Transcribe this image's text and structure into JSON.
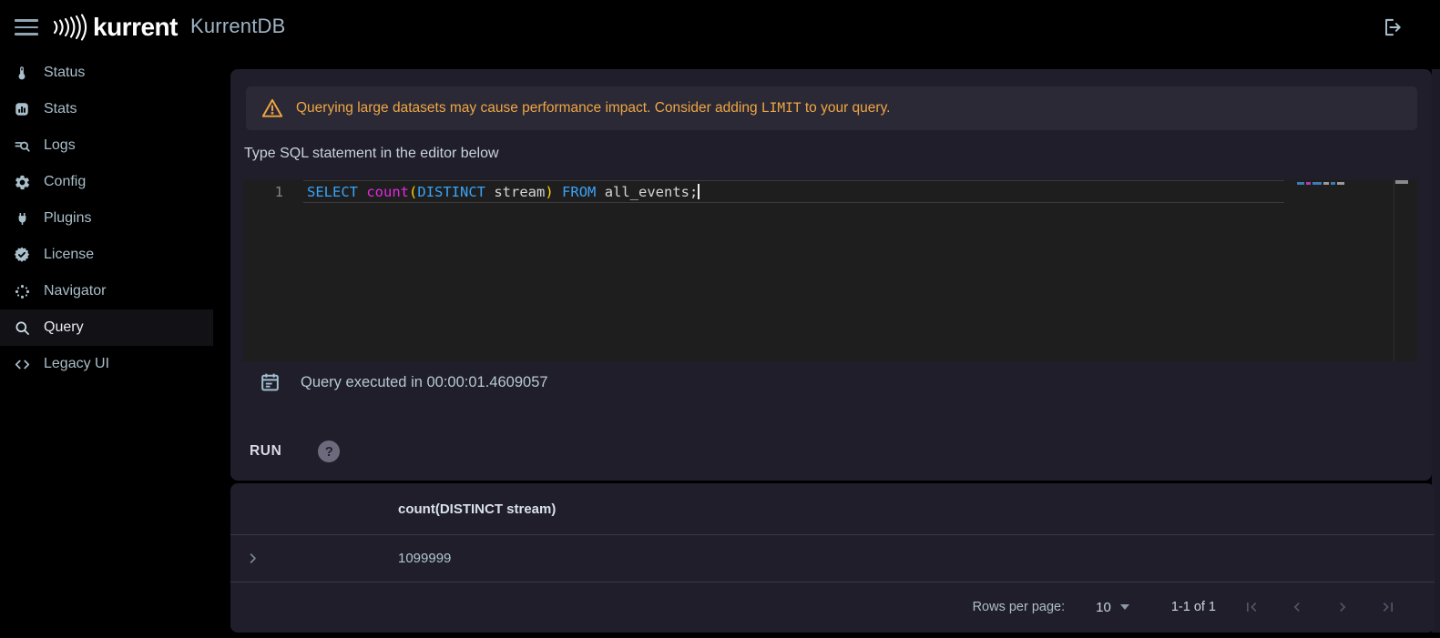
{
  "header": {
    "brand": "kurrent",
    "app_title": "KurrentDB"
  },
  "sidebar": {
    "items": [
      {
        "label": "Status",
        "icon": "thermometer-icon",
        "selected": false
      },
      {
        "label": "Stats",
        "icon": "bar-chart-icon",
        "selected": false
      },
      {
        "label": "Logs",
        "icon": "log-search-icon",
        "selected": false
      },
      {
        "label": "Config",
        "icon": "gear-icon",
        "selected": false
      },
      {
        "label": "Plugins",
        "icon": "plug-icon",
        "selected": false
      },
      {
        "label": "License",
        "icon": "license-badge-icon",
        "selected": false
      },
      {
        "label": "Navigator",
        "icon": "navigator-dots-icon",
        "selected": false
      },
      {
        "label": "Query",
        "icon": "search-icon",
        "selected": true
      },
      {
        "label": "Legacy UI",
        "icon": "code-brackets-icon",
        "selected": false
      }
    ]
  },
  "query_panel": {
    "warning": {
      "text_before": "Querying large datasets may cause performance impact. Consider adding ",
      "code": "LIMIT",
      "text_after": " to your query."
    },
    "editor_label": "Type SQL statement in the editor below",
    "editor": {
      "line_number": "1",
      "tokens": [
        {
          "text": "SELECT",
          "type": "keyword"
        },
        {
          "text": " ",
          "type": "plain"
        },
        {
          "text": "count",
          "type": "function"
        },
        {
          "text": "(",
          "type": "paren"
        },
        {
          "text": "DISTINCT",
          "type": "keyword"
        },
        {
          "text": " stream",
          "type": "plain"
        },
        {
          "text": ")",
          "type": "paren"
        },
        {
          "text": " ",
          "type": "plain"
        },
        {
          "text": "FROM",
          "type": "keyword"
        },
        {
          "text": " all_events;",
          "type": "plain"
        }
      ]
    },
    "execution_status": "Query executed in 00:00:01.4609057",
    "run_label": "RUN",
    "help_label": "?"
  },
  "results": {
    "columns": [
      "count(DISTINCT stream)"
    ],
    "rows": [
      [
        "1099999"
      ]
    ],
    "pagination": {
      "rows_per_page_label": "Rows per page:",
      "rows_per_page_value": "10",
      "range_label": "1-1 of 1"
    }
  },
  "colors": {
    "warning_accent": "#efa643",
    "sql_keyword": "#3ba3f8",
    "sql_function": "#e12ae1",
    "sql_paren": "#ffd602",
    "sql_plain": "#d4d4d4",
    "panel_bg": "#201e2b",
    "editor_bg": "#1e1e1e",
    "sidebar_text": "#a9bfcb"
  }
}
